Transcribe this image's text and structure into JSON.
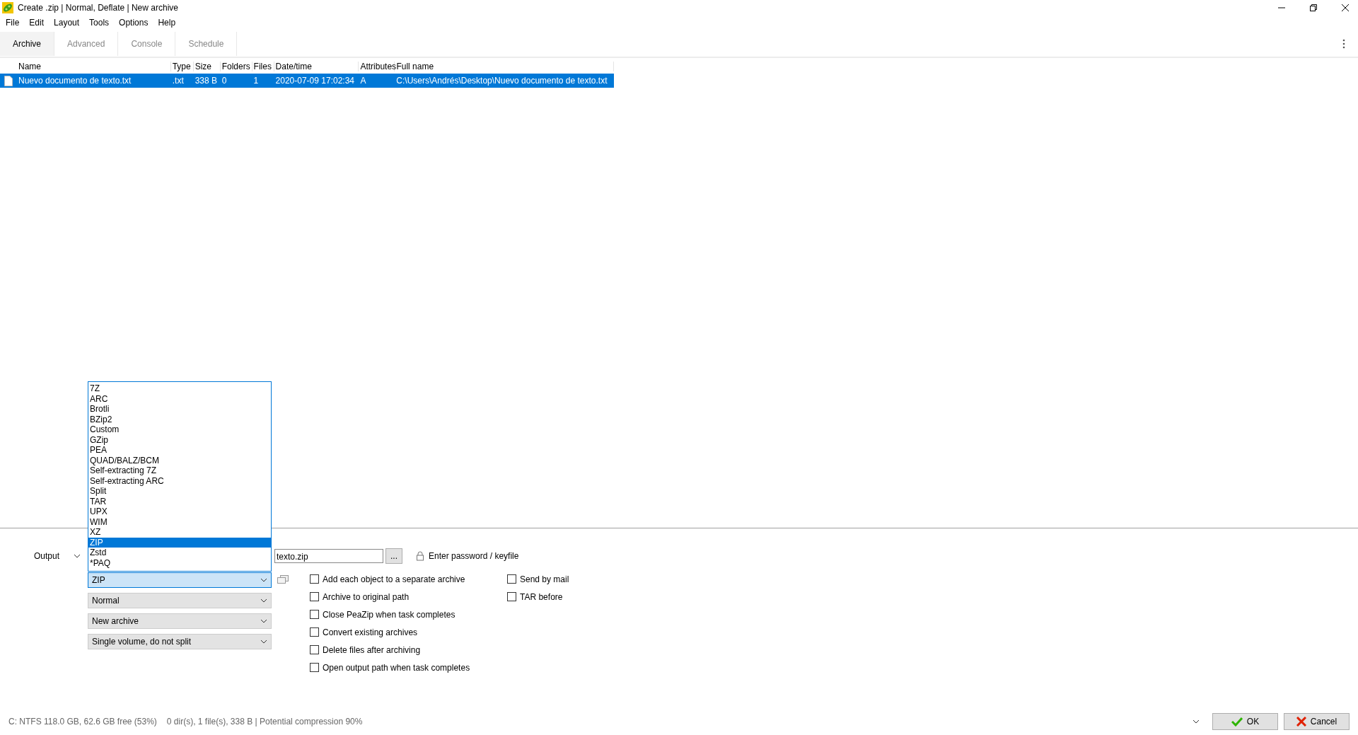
{
  "window": {
    "title": "Create .zip | Normal, Deflate | New archive"
  },
  "menu": [
    "File",
    "Edit",
    "Layout",
    "Tools",
    "Options",
    "Help"
  ],
  "tabs": [
    {
      "label": "Archive",
      "selected": true
    },
    {
      "label": "Advanced",
      "selected": false
    },
    {
      "label": "Console",
      "selected": false
    },
    {
      "label": "Schedule",
      "selected": false
    }
  ],
  "table": {
    "columns": [
      "Name",
      "Type",
      "Size",
      "Folders",
      "Files",
      "Date/time",
      "Attributes",
      "Full name"
    ],
    "rows": [
      {
        "selected": true,
        "cells": [
          "Nuevo documento de texto.txt",
          ".txt",
          "338 B",
          "0",
          "1",
          "2020-07-09 17:02:34",
          "A",
          "C:\\Users\\Andrés\\Desktop\\Nuevo documento de texto.txt"
        ]
      }
    ]
  },
  "output": {
    "label": "Output",
    "value": "texto.zip",
    "browse": "...",
    "password": "Enter password / keyfile"
  },
  "combos": [
    {
      "value": "ZIP",
      "open": true
    },
    {
      "value": "Normal",
      "open": false
    },
    {
      "value": "New archive",
      "open": false
    },
    {
      "value": "Single volume, do not split",
      "open": false
    }
  ],
  "dropdown": {
    "items": [
      {
        "label": "7Z",
        "selected": false
      },
      {
        "label": "ARC",
        "selected": false
      },
      {
        "label": "Brotli",
        "selected": false
      },
      {
        "label": "BZip2",
        "selected": false
      },
      {
        "label": "Custom",
        "selected": false
      },
      {
        "label": "GZip",
        "selected": false
      },
      {
        "label": "PEA",
        "selected": false
      },
      {
        "label": "QUAD/BALZ/BCM",
        "selected": false
      },
      {
        "label": "Self-extracting 7Z",
        "selected": false
      },
      {
        "label": "Self-extracting ARC",
        "selected": false
      },
      {
        "label": "Split",
        "selected": false
      },
      {
        "label": "TAR",
        "selected": false
      },
      {
        "label": "UPX",
        "selected": false
      },
      {
        "label": "WIM",
        "selected": false
      },
      {
        "label": "XZ",
        "selected": false
      },
      {
        "label": "ZIP",
        "selected": true
      },
      {
        "label": "Zstd",
        "selected": false
      },
      {
        "label": "*PAQ",
        "selected": false
      }
    ]
  },
  "options_left": [
    {
      "label": "Add each object to a separate archive",
      "checked": false
    },
    {
      "label": "Archive to original path",
      "checked": false
    },
    {
      "label": "Close PeaZip when task completes",
      "checked": false
    },
    {
      "label": "Convert existing archives",
      "checked": false
    },
    {
      "label": "Delete files after archiving",
      "checked": false
    },
    {
      "label": "Open output path when task completes",
      "checked": false
    }
  ],
  "options_right": [
    {
      "label": "Send by mail",
      "checked": false
    },
    {
      "label": "TAR before",
      "checked": false
    }
  ],
  "status_bar": {
    "drive": "C: NTFS 118.0 GB, 62.6 GB free (53%)",
    "summary": "0 dir(s), 1 file(s), 338 B | Potential compression 90%"
  },
  "buttons": [
    {
      "kind": "ok",
      "label": "OK"
    },
    {
      "kind": "cancel",
      "label": "Cancel"
    }
  ]
}
